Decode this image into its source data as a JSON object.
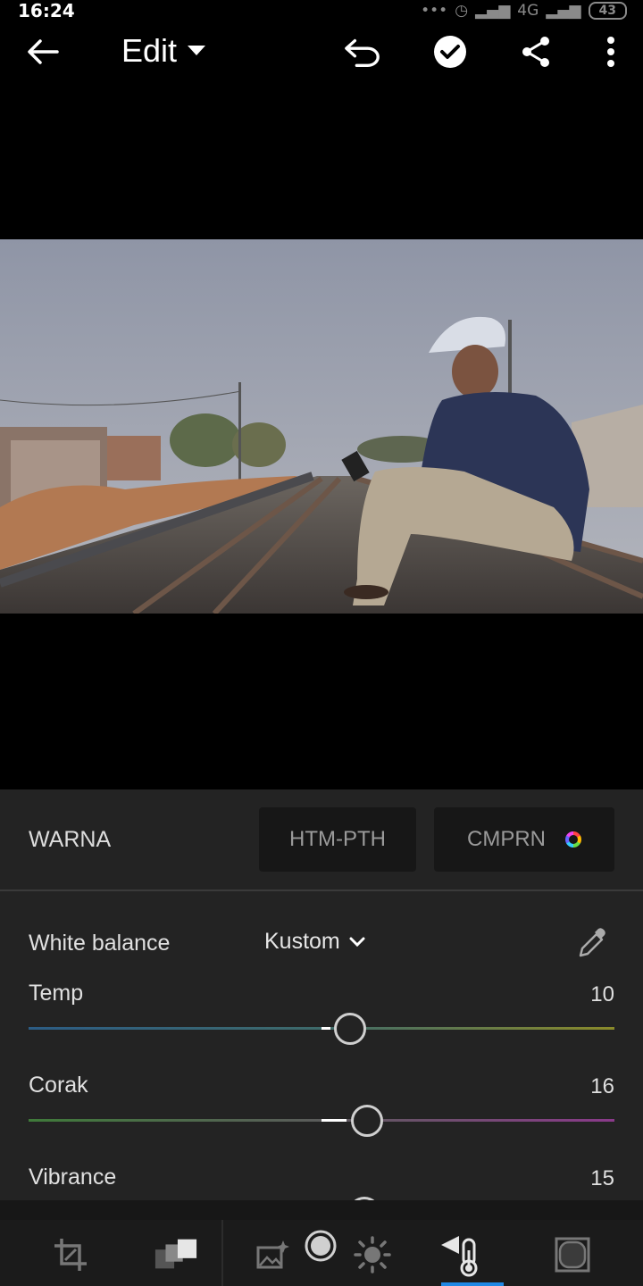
{
  "status_bar": {
    "time": "16:24",
    "network": "4G",
    "battery": "43"
  },
  "toolbar": {
    "title": "Edit"
  },
  "panel": {
    "section_title": "WARNA",
    "bw_button": "HTM-PTH",
    "compare_button": "CMPRN",
    "white_balance": {
      "label": "White balance",
      "value": "Kustom"
    },
    "sliders": [
      {
        "label": "Temp",
        "value": "10"
      },
      {
        "label": "Corak",
        "value": "16"
      },
      {
        "label": "Vibrance",
        "value": "15"
      }
    ]
  },
  "icons": {
    "back": "back-arrow-icon",
    "dropdown": "caret-down-icon",
    "undo": "undo-icon",
    "done": "check-circle-icon",
    "share": "share-icon",
    "more": "more-vert-icon",
    "eyedropper": "eyedropper-icon",
    "crop": "crop-icon",
    "presets": "presets-icon",
    "auto": "auto-enhance-icon",
    "selective": "selective-icon",
    "light": "light-icon",
    "color": "color-temperature-icon",
    "vignette": "vignette-icon"
  }
}
